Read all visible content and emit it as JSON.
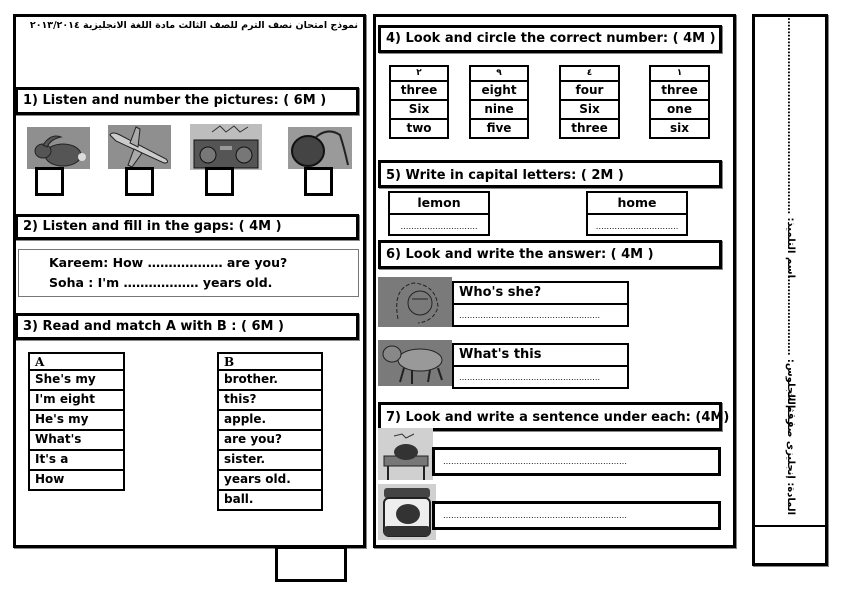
{
  "header": {
    "title_ar": "نموذج امتحان نصف الترم للصف الثالث مادة اللغة الانجليزية ٢٠١٣/٢٠١٤"
  },
  "section1": {
    "title": "1) Listen and number the pictures: ( 6M )",
    "pictures": [
      {
        "icon": "rabbit-icon",
        "answer": ""
      },
      {
        "icon": "airplane-icon",
        "answer": ""
      },
      {
        "icon": "radio-icon",
        "answer": ""
      },
      {
        "icon": "yoyo-icon",
        "answer": ""
      }
    ]
  },
  "section2": {
    "title": "2) Listen and fill in the gaps: ( 4M )",
    "lines": [
      "Kareem: How ……………… are you?",
      "Soha : I'm ……………… years old."
    ]
  },
  "section3": {
    "title": "3) Read and match A   with B : ( 6M )",
    "col_a_header": "A",
    "col_a": [
      "She's my",
      "I'm eight",
      "He's my",
      "What's",
      "It's a",
      "How"
    ],
    "col_b_header": "B",
    "col_b": [
      "brother.",
      "this?",
      "apple.",
      "are you?",
      "sister.",
      "years old.",
      "ball."
    ]
  },
  "section4": {
    "title": "4) Look and circle the correct number: ( 4M )",
    "groups": [
      {
        "numeral": "٢",
        "options": [
          "three",
          "Six",
          "two"
        ]
      },
      {
        "numeral": "٩",
        "options": [
          "eight",
          "nine",
          "five"
        ]
      },
      {
        "numeral": "٤",
        "options": [
          "four",
          "Six",
          "three"
        ]
      },
      {
        "numeral": "١",
        "options": [
          "three",
          "one",
          "six"
        ]
      }
    ]
  },
  "section5": {
    "title": "5) Write in capital letters: ( 2M )",
    "words": [
      {
        "word": "lemon",
        "blank": "………………….……."
      },
      {
        "word": "home",
        "blank": "…………………………."
      }
    ]
  },
  "section6": {
    "title": "6) Look and write the answer: ( 4M )",
    "items": [
      {
        "icon": "grandmother-icon",
        "question": "Who's she?",
        "blank": "……………………………………….……."
      },
      {
        "icon": "sheep-icon",
        "question": "What's this",
        "blank": "……………………………………….……."
      }
    ]
  },
  "section7": {
    "title": "7) Look and write a sentence under each: (4M)",
    "items": [
      {
        "icon": "sleeping-boy-icon",
        "blank": "……………………………………………………………"
      },
      {
        "icon": "jam-jar-icon",
        "blank": "……………………………………………………………"
      }
    ]
  },
  "student_info": {
    "name_label": "اسم التلميذ: ……………………………………………………",
    "seat_label": "رقم الجلوس: ……………………",
    "subject_label": "المادة: إنجليزى صف ثالث"
  }
}
